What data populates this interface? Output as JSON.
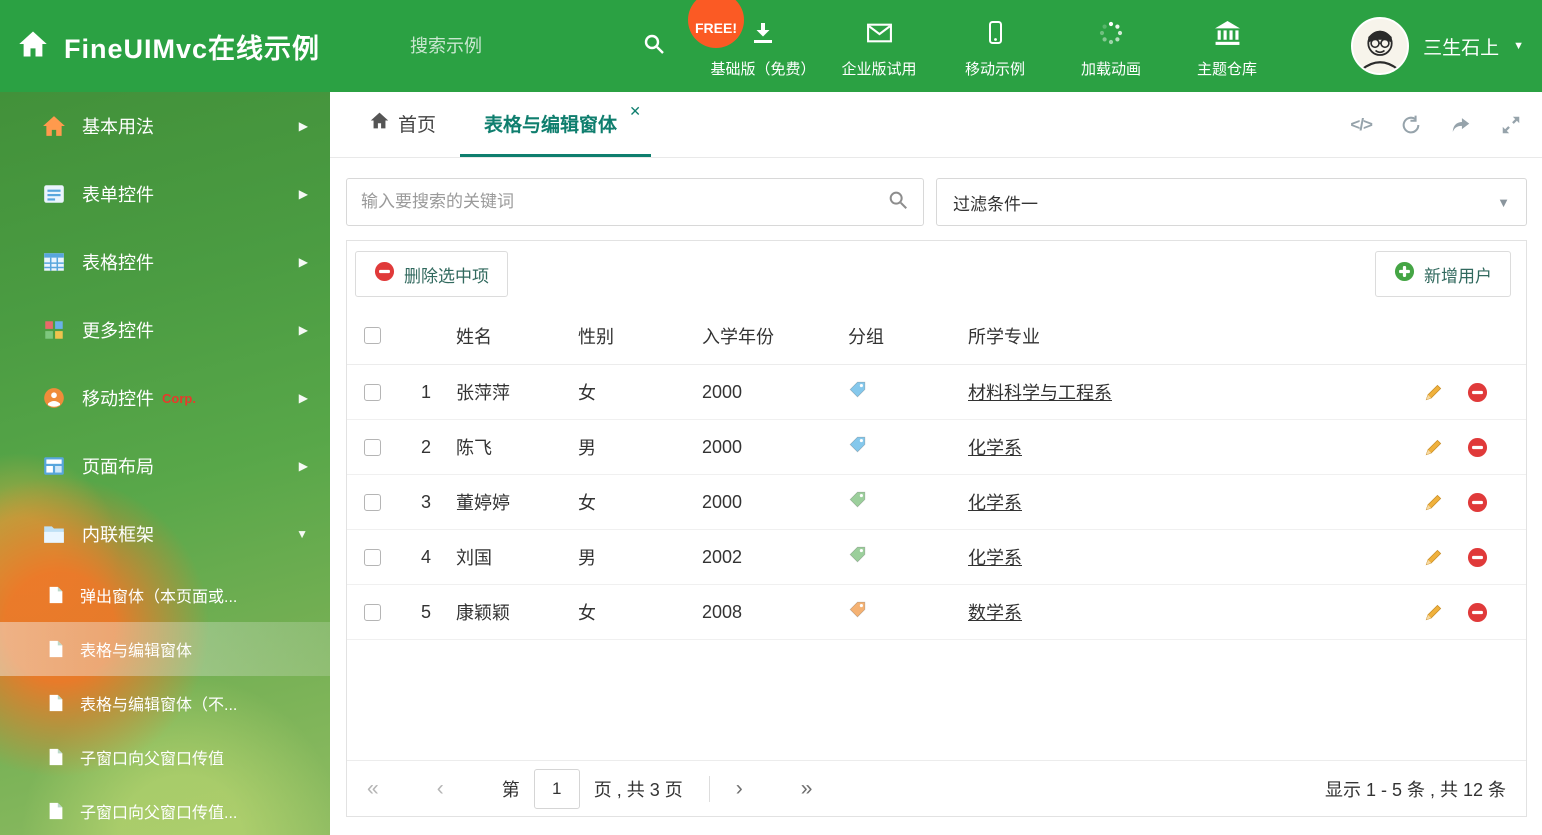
{
  "header": {
    "title": "FineUIMvc在线示例",
    "search_placeholder": "搜索示例",
    "free_badge": "FREE!",
    "nav": [
      {
        "label": "基础版（免费）"
      },
      {
        "label": "企业版试用"
      },
      {
        "label": "移动示例"
      },
      {
        "label": "加载动画"
      },
      {
        "label": "主题仓库"
      }
    ],
    "user_name": "三生石上"
  },
  "sidebar": {
    "items": [
      {
        "label": "基本用法"
      },
      {
        "label": "表单控件"
      },
      {
        "label": "表格控件"
      },
      {
        "label": "更多控件"
      },
      {
        "label": "移动控件",
        "badge": "Corp."
      },
      {
        "label": "页面布局"
      },
      {
        "label": "内联框架"
      }
    ],
    "subitems": [
      {
        "label": "弹出窗体（本页面或..."
      },
      {
        "label": "表格与编辑窗体"
      },
      {
        "label": "表格与编辑窗体（不..."
      },
      {
        "label": "子窗口向父窗口传值"
      },
      {
        "label": "子窗口向父窗口传值..."
      }
    ]
  },
  "tabs": {
    "home": "首页",
    "active": "表格与编辑窗体",
    "close_glyph": "✕"
  },
  "filter": {
    "search_placeholder": "输入要搜索的关键词",
    "filter_value": "过滤条件一"
  },
  "grid": {
    "delete_button": "删除选中项",
    "add_button": "新增用户",
    "columns": {
      "name": "姓名",
      "gender": "性别",
      "year": "入学年份",
      "group": "分组",
      "major": "所学专业"
    },
    "rows": [
      {
        "num": "1",
        "name": "张萍萍",
        "gender": "女",
        "year": "2000",
        "tag_color": "#85c8ec",
        "major": "材料科学与工程系"
      },
      {
        "num": "2",
        "name": "陈飞",
        "gender": "男",
        "year": "2000",
        "tag_color": "#85c8ec",
        "major": "化学系"
      },
      {
        "num": "3",
        "name": "董婷婷",
        "gender": "女",
        "year": "2000",
        "tag_color": "#9ccf9c",
        "major": "化学系"
      },
      {
        "num": "4",
        "name": "刘国",
        "gender": "男",
        "year": "2002",
        "tag_color": "#9ccf9c",
        "major": "化学系"
      },
      {
        "num": "5",
        "name": "康颖颖",
        "gender": "女",
        "year": "2008",
        "tag_color": "#f5b273",
        "major": "数学系"
      }
    ]
  },
  "pagination": {
    "prefix": "第",
    "page": "1",
    "suffix": "页 , 共 3 页",
    "first": "«",
    "prev": "‹",
    "next": "›",
    "last": "»",
    "summary": "显示 1 - 5 条 , 共 12 条"
  },
  "colors": {
    "theme_green": "#2ba143",
    "active_tab_teal": "#0f7e6e",
    "free_badge_orange": "#fb5a24",
    "danger_red": "#e03a3a",
    "success_green": "#45a545"
  }
}
